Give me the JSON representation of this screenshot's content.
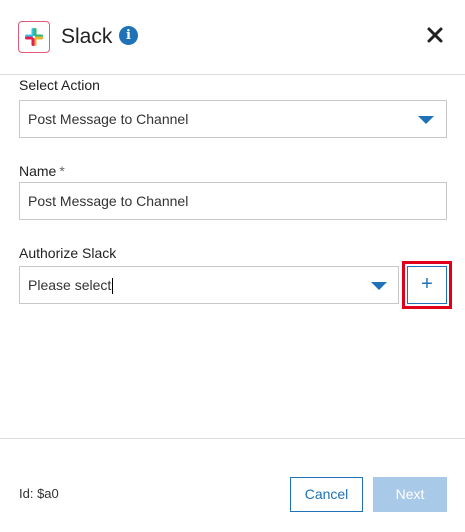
{
  "header": {
    "app_logo_icon": "slack-logo-icon",
    "title": "Slack",
    "info_icon": "info-icon",
    "info_glyph": "i",
    "close_icon": "close-icon"
  },
  "form": {
    "select_action": {
      "label": "Select Action",
      "value": "Post Message to Channel"
    },
    "name": {
      "label": "Name",
      "required_marker": "*",
      "value": "Post Message to Channel"
    },
    "authorize": {
      "label": "Authorize Slack",
      "value": "Please select",
      "add_button_label": "+"
    }
  },
  "footer": {
    "id_text": "Id: $a0",
    "cancel_label": "Cancel",
    "next_label": "Next"
  },
  "colors": {
    "accent": "#1f72b8",
    "highlight": "#e0001b",
    "next_disabled": "#a9c9e8"
  }
}
